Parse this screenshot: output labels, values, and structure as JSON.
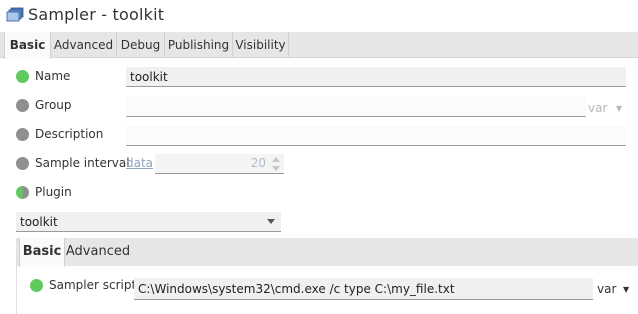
{
  "window": {
    "title": "Sampler - toolkit",
    "icon": "sampler-window-icon"
  },
  "tabs": [
    {
      "label": "Basic",
      "active": true
    },
    {
      "label": "Advanced",
      "active": false
    },
    {
      "label": "Debug",
      "active": false
    },
    {
      "label": "Publishing",
      "active": false
    },
    {
      "label": "Visibility",
      "active": false
    }
  ],
  "form": {
    "name": {
      "label": "Name",
      "value": "toolkit",
      "status": "green"
    },
    "group": {
      "label": "Group",
      "value": "",
      "status": "gray",
      "var_label": "var"
    },
    "description": {
      "label": "Description",
      "value": "",
      "status": "gray"
    },
    "sample_interval": {
      "label": "Sample interval",
      "link": "data",
      "value": "20",
      "status": "gray"
    },
    "plugin": {
      "label": "Plugin",
      "status": "half",
      "selected": "toolkit"
    }
  },
  "plugin_panel": {
    "tabs": [
      {
        "label": "Basic",
        "active": true
      },
      {
        "label": "Advanced",
        "active": false
      }
    ],
    "sampler_script": {
      "label": "Sampler script",
      "value": "C:\\Windows\\system32\\cmd.exe /c type C:\\my_file.txt",
      "var_label": "var",
      "status": "green"
    }
  },
  "colors": {
    "status_green": "#5fcb5f",
    "status_gray": "#8f8f8f",
    "tabbar_bg": "#e6e6e6"
  }
}
